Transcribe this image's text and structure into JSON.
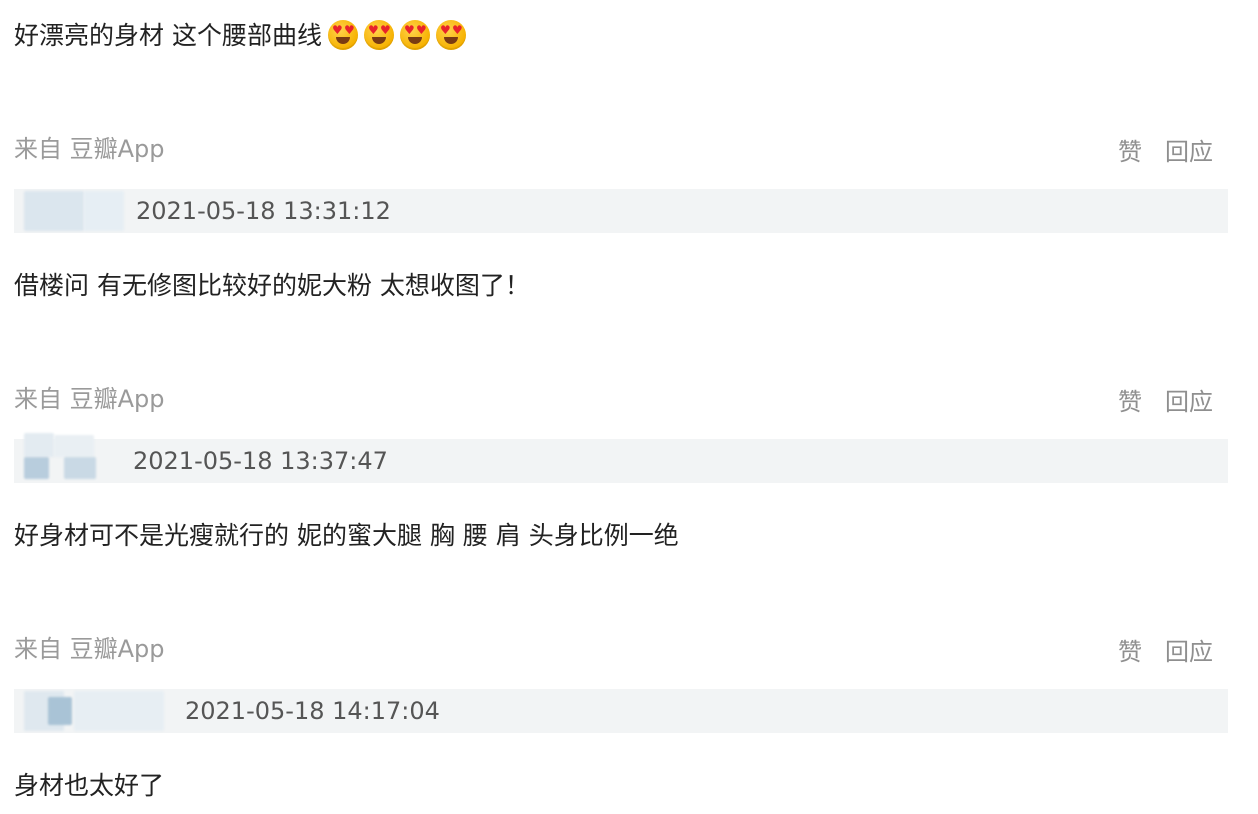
{
  "comments": [
    {
      "text": "好漂亮的身材 这个腰部曲线",
      "emojis": [
        "heart-eyes",
        "heart-eyes",
        "heart-eyes",
        "heart-eyes"
      ],
      "source": "来自 豆瓣App",
      "like": "赞",
      "reply": "回应"
    },
    {
      "timestamp": "2021-05-18 13:31:12",
      "text": "借楼问 有无修图比较好的妮大粉 太想收图了！",
      "source": "来自 豆瓣App",
      "like": "赞",
      "reply": "回应"
    },
    {
      "timestamp": "2021-05-18 13:37:47",
      "text": "好身材可不是光瘦就行的 妮的蜜大腿 胸 腰 肩 头身比例一绝",
      "source": "来自 豆瓣App",
      "like": "赞",
      "reply": "回应"
    },
    {
      "timestamp": "2021-05-18 14:17:04",
      "text": "身材也太好了"
    }
  ],
  "colors": {
    "text": "#222222",
    "muted": "#9a9a9a",
    "action": "#8f8f8f",
    "meta_bar": "#f2f4f5",
    "emoji_face": "#f6b100",
    "emoji_heart": "#e8232a",
    "avatar_blur_a": "#dbe6ee",
    "avatar_blur_b": "#a9c3d6"
  }
}
